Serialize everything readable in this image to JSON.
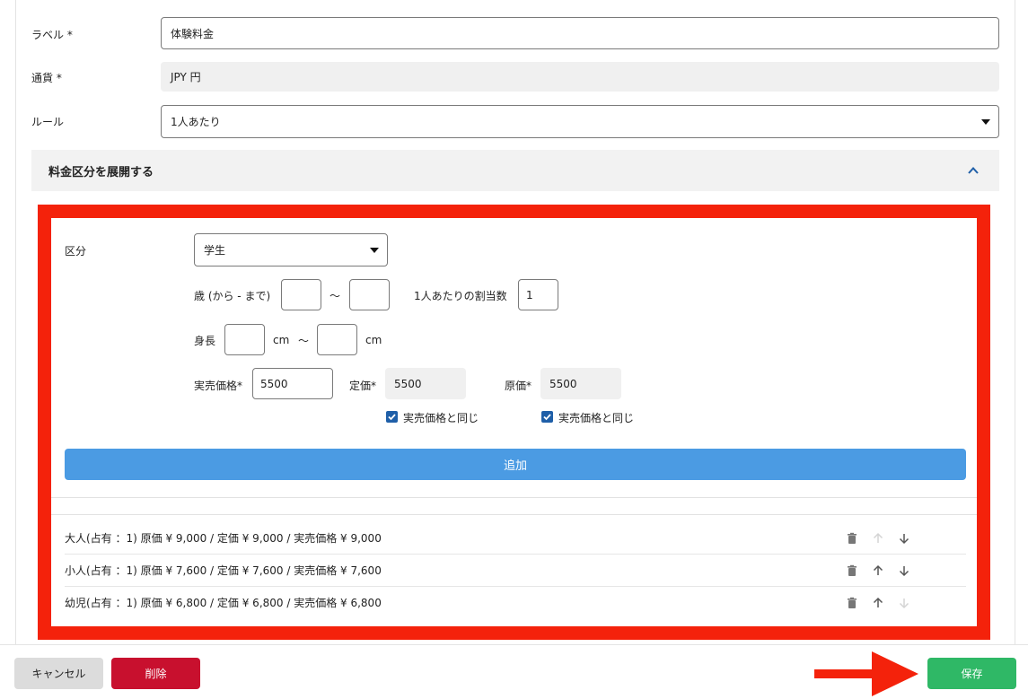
{
  "form": {
    "label_field": {
      "label": "ラベル *",
      "value": "体験料金"
    },
    "currency_field": {
      "label": "通貨 *",
      "value": "JPY 円"
    },
    "rule_field": {
      "label": "ルール",
      "value": "1人あたり"
    }
  },
  "accordion": {
    "title": "料金区分を展開する",
    "icon": "chevron-up-icon"
  },
  "category_panel": {
    "category_label": "区分",
    "category_value": "学生",
    "age_label": "歳 (から - まで)",
    "age_from": "",
    "age_to": "",
    "tilde": "～",
    "allocation_label": "1人あたりの割当数",
    "allocation_value": "1",
    "height_label": "身長",
    "height_from": "",
    "height_to": "",
    "cm_unit": "cm",
    "selling_price_label": "実売価格*",
    "selling_price_value": "5500",
    "list_price_label": "定価*",
    "list_price_value": "5500",
    "cost_price_label": "原価*",
    "cost_price_value": "5500",
    "same_as_selling_label": "実売価格と同じ",
    "add_button": "追加"
  },
  "price_list": [
    {
      "text": "大人(占有 ：1) 原価 ¥ 9,000 / 定価 ¥ 9,000 / 実売価格 ¥ 9,000",
      "up_enabled": false,
      "down_enabled": true
    },
    {
      "text": "小人(占有 ：1) 原価 ¥ 7,600 / 定価 ¥ 7,600 / 実売価格 ¥ 7,600",
      "up_enabled": true,
      "down_enabled": true
    },
    {
      "text": "幼児(占有 ：1) 原価 ¥ 6,800 / 定価 ¥ 6,800 / 実売価格 ¥ 6,800",
      "up_enabled": true,
      "down_enabled": false
    }
  ],
  "footer": {
    "cancel": "キャンセル",
    "delete": "削除",
    "save": "保存"
  },
  "colors": {
    "highlight": "#f4220b",
    "add_button": "#4b9be3",
    "save": "#2fb866",
    "delete": "#c8102e",
    "checkbox": "#1f5fa8"
  }
}
